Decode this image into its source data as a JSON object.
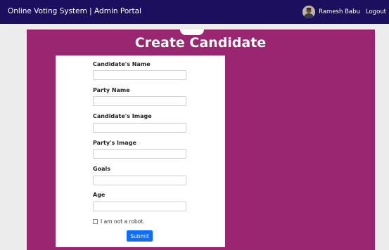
{
  "navbar": {
    "brand": "Online Voting System | Admin Portal",
    "user_name": "Ramesh Babu",
    "logout_label": "Logout"
  },
  "form": {
    "title": "Create Candidate",
    "fields": [
      {
        "label": "Candidate's Name",
        "value": ""
      },
      {
        "label": "Party Name",
        "value": ""
      },
      {
        "label": "Candidate's Image",
        "value": ""
      },
      {
        "label": "Party's Image",
        "value": ""
      },
      {
        "label": "Goals",
        "value": ""
      },
      {
        "label": "Age",
        "value": ""
      }
    ],
    "captcha_label": "I am not a robot.",
    "submit_label": "Submit"
  },
  "colors": {
    "navbar_bg": "#1b0f5e",
    "panel_bg": "#9a2570",
    "page_bg": "#ececec",
    "button_bg": "#0d6efd"
  },
  "icons": {
    "avatar": "user-avatar-photo",
    "captcha": "checkbox-icon"
  }
}
